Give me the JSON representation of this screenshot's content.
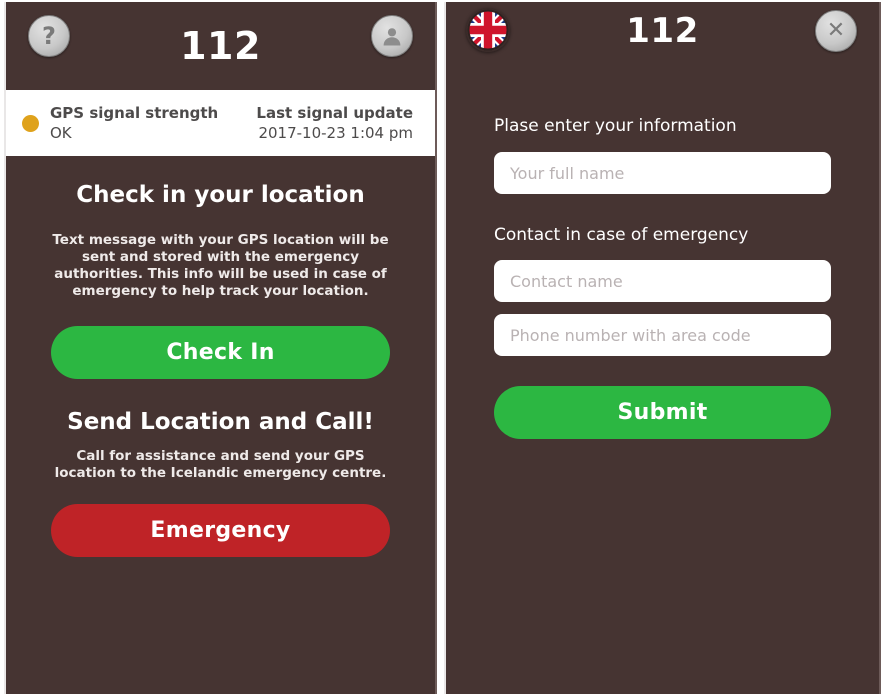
{
  "left_screen": {
    "header": {
      "title": "112",
      "help_button_label": "?",
      "help_icon": "question-mark-icon",
      "profile_icon": "user-avatar-icon"
    },
    "status_bar": {
      "signal_label": "GPS signal strength",
      "signal_value": "OK",
      "signal_dot_color": "#dfa21c",
      "update_label": "Last signal update",
      "update_value": "2017-10-23 1:04 pm"
    },
    "checkin_section": {
      "title": "Check in your location",
      "description": "Text message with your GPS location will be sent and stored with the emergency authorities. This info will be used in case of emergency to help track your location.",
      "button_label": "Check In",
      "button_color": "#2cb742"
    },
    "emergency_section": {
      "title": "Send Location and Call!",
      "description": "Call for assistance and send your GPS location to the Icelandic emergency centre.",
      "button_label": "Emergency",
      "button_color": "#bf2327"
    }
  },
  "right_screen": {
    "header": {
      "title": "112",
      "language_icon": "uk-flag-icon",
      "close_icon": "close-x-icon"
    },
    "form": {
      "heading": "Plase enter your information",
      "full_name_placeholder": "Your full name",
      "contact_heading": "Contact in case of emergency",
      "contact_name_placeholder": "Contact name",
      "phone_placeholder": "Phone number with area code",
      "full_name_value": "",
      "contact_name_value": "",
      "phone_value": "",
      "submit_label": "Submit",
      "submit_color": "#2cb742"
    }
  },
  "theme": {
    "background": "#463432",
    "panel_border": "#e9e7e7"
  }
}
